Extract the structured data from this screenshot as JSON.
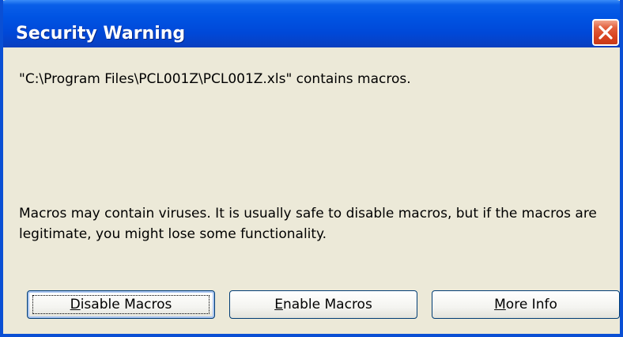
{
  "window": {
    "title": "Security Warning",
    "close_icon": "close-icon"
  },
  "message": {
    "file_notice": "\"C:\\Program Files\\PCL001Z\\PCL001Z.xls\" contains macros.",
    "warning": "Macros may contain viruses. It is usually safe to disable macros, but if the macros are legitimate, you might lose some functionality."
  },
  "buttons": {
    "disable": {
      "mnemonic": "D",
      "rest": "isable Macros"
    },
    "enable": {
      "mnemonic": "E",
      "rest": "nable Macros"
    },
    "more_info": {
      "mnemonic": "M",
      "rest": "ore Info"
    }
  },
  "colors": {
    "titlebar": "#0054e3",
    "window_bg": "#ece9d8",
    "close_button": "#d8421f"
  }
}
